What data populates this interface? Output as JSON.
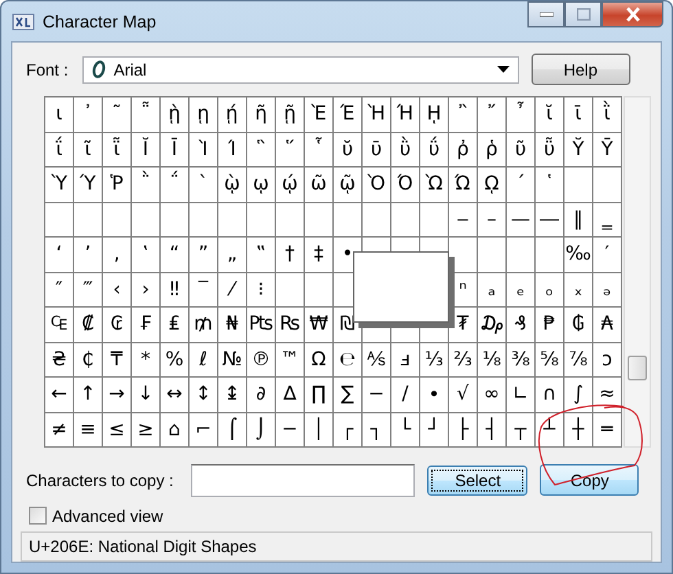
{
  "window": {
    "title": "Character Map"
  },
  "font": {
    "label": "Font :",
    "value": "Arial"
  },
  "help_button": {
    "label": "Help"
  },
  "grid": {
    "rows": [
      [
        "ι",
        "᾿",
        "῀",
        "῁",
        "ῂ",
        "ῃ",
        "ῄ",
        "ῆ",
        "ῇ",
        "Ὲ",
        "Έ",
        "Ὴ",
        "Ή",
        "ῌ",
        "῍",
        "῎",
        "῏",
        "ῐ",
        "ῑ",
        "ῒ"
      ],
      [
        "ΐ",
        "ῖ",
        "ῗ",
        "Ῐ",
        "Ῑ",
        "Ὶ",
        "Ί",
        "῝",
        "῞",
        "῟",
        "ῠ",
        "ῡ",
        "ῢ",
        "ΰ",
        "ῤ",
        "ῥ",
        "ῦ",
        "ῧ",
        "Ῠ",
        "Ῡ"
      ],
      [
        "Ὺ",
        "Ύ",
        "Ῥ",
        "῭",
        "΅",
        "`",
        "ῲ",
        "ῳ",
        "ῴ",
        "ῶ",
        "ῷ",
        "Ὸ",
        "Ό",
        "Ὼ",
        "Ώ",
        "ῼ",
        "´",
        "῾",
        null,
        null
      ],
      [
        null,
        null,
        null,
        null,
        null,
        null,
        null,
        null,
        null,
        null,
        null,
        null,
        null,
        null,
        "‒",
        "–",
        "—",
        "―",
        "‖",
        "‗"
      ],
      [
        "‘",
        "’",
        "‚",
        "‛",
        "“",
        "”",
        "„",
        "‟",
        "†",
        "‡",
        "•",
        null,
        null,
        null,
        null,
        null,
        null,
        null,
        "‰",
        "′"
      ],
      [
        "″",
        "‴",
        "‹",
        "›",
        "‼",
        "‾",
        "⁄",
        "⁝",
        null,
        null,
        null,
        null,
        null,
        null,
        "ⁿ",
        "ₐ",
        "ₑ",
        "ₒ",
        "ₓ",
        "ₔ"
      ],
      [
        "₠",
        "₡",
        "₢",
        "₣",
        "₤",
        "₥",
        "₦",
        "₧",
        "₨",
        "₩",
        "₪",
        null,
        null,
        null,
        "₮",
        "₯",
        "₰",
        "₱",
        "₲",
        "₳"
      ],
      [
        "₴",
        "₵",
        "₸",
        "*",
        "%",
        "ℓ",
        "№",
        "℗",
        "™",
        "Ω",
        "℮",
        "⅍",
        "ⅎ",
        "⅓",
        "⅔",
        "⅛",
        "⅜",
        "⅝",
        "⅞",
        "ↄ"
      ],
      [
        "←",
        "↑",
        "→",
        "↓",
        "↔",
        "↕",
        "↨",
        "∂",
        "∆",
        "∏",
        "∑",
        "−",
        "∕",
        "∙",
        "√",
        "∞",
        "∟",
        "∩",
        "∫",
        "≈"
      ],
      [
        "≠",
        "≡",
        "≤",
        "≥",
        "⌂",
        "⌐",
        "⌠",
        "⌡",
        "─",
        "│",
        "┌",
        "┐",
        "└",
        "┘",
        "├",
        "┤",
        "┬",
        "┴",
        "┼",
        "═"
      ]
    ]
  },
  "copy_field": {
    "label": "Characters to copy :"
  },
  "buttons": [
    {
      "label": "Select",
      "focused": true
    },
    {
      "label": "Copy",
      "focused": false
    }
  ],
  "advanced_view": {
    "label": "Advanced view",
    "checked": false
  },
  "status_bar": {
    "text": "U+206E: National Digit Shapes"
  }
}
